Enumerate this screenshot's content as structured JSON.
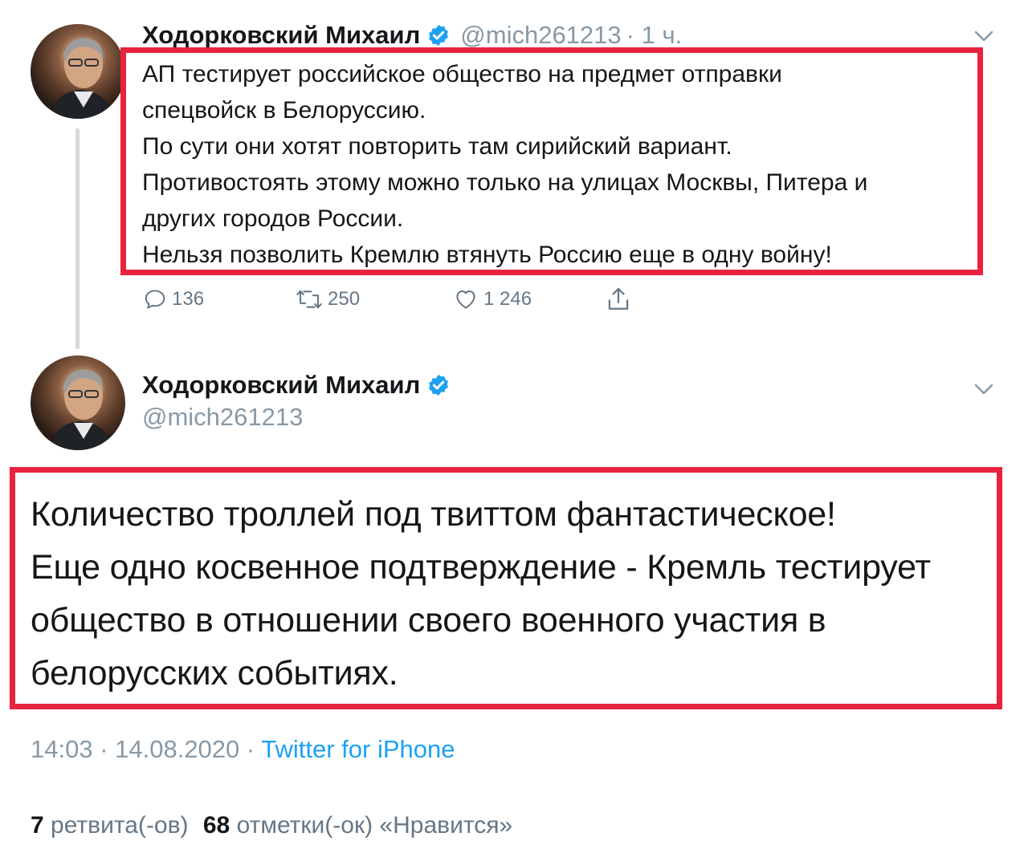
{
  "tweet1": {
    "author_name": "Ходорковский Михаил",
    "handle": "@mich261213",
    "time": "· 1 ч.",
    "lines": [
      "АП тестирует российское общество на предмет отправки",
      "спецвойск в Белоруссию.",
      "По сути они хотят повторить там сирийский вариант.",
      "Противостоять этому можно только на улицах Москвы, Питера и",
      "других городов России.",
      "Нельзя позволить Кремлю втянуть Россию еще в одну войну!"
    ],
    "actions": {
      "replies": "136",
      "retweets": "250",
      "likes": "1 246"
    }
  },
  "tweet2": {
    "author_name": "Ходорковский Михаил",
    "handle": "@mich261213",
    "lines": [
      "Количество троллей под твиттом фантастическое!",
      "Еще одно косвенное подтверждение - Кремль тестирует",
      "общество в отношении своего военного участия в",
      "белорусских событиях."
    ],
    "timestamp": "14:03 · 14.08.2020 ·",
    "source": "Twitter for iPhone",
    "stats": {
      "retweets_count": "7",
      "retweets_label": "ретвита(-ов)",
      "likes_count": "68",
      "likes_label": "отметки(-ок) «Нравится»"
    }
  },
  "colors": {
    "highlight": "#e8233e",
    "link": "#1da1f2",
    "muted": "#8899a6",
    "verified": "#1da1f2"
  },
  "icons": [
    "reply-icon",
    "retweet-icon",
    "like-icon",
    "share-icon",
    "verified-badge-icon",
    "chevron-down-icon"
  ]
}
